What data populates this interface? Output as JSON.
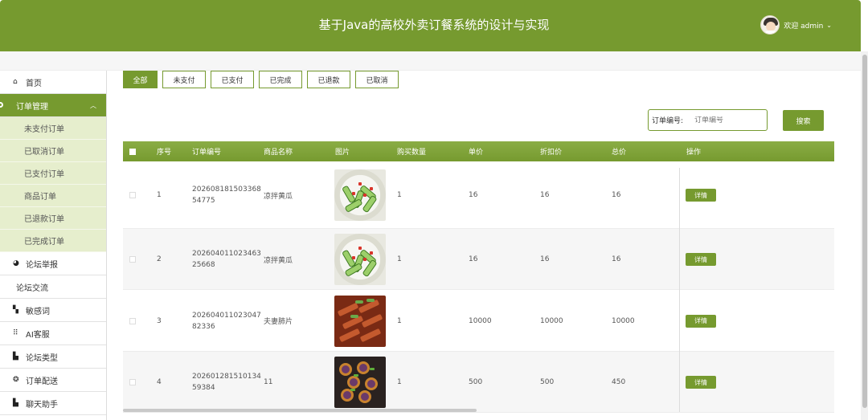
{
  "header": {
    "title": "基于Java的高校外卖订餐系统的设计与实现",
    "welcome": "欢迎 admin"
  },
  "sidebar": {
    "items": [
      {
        "label": "首页",
        "icon": "home-icon"
      },
      {
        "label": "订单管理",
        "icon": "gear-icon"
      },
      {
        "label": "未支付订单"
      },
      {
        "label": "已取消订单"
      },
      {
        "label": "已支付订单"
      },
      {
        "label": "商品订单"
      },
      {
        "label": "已退款订单"
      },
      {
        "label": "已完成订单"
      },
      {
        "label": "论坛举报",
        "icon": "pie-icon"
      },
      {
        "label": "论坛交流"
      },
      {
        "label": "敏感词",
        "icon": "grid-icon"
      },
      {
        "label": "AI客服",
        "icon": "dots-grid-icon"
      },
      {
        "label": "论坛类型",
        "icon": "folder-icon"
      },
      {
        "label": "订单配送",
        "icon": "globe-icon"
      },
      {
        "label": "聊天助手",
        "icon": "chat-icon"
      }
    ]
  },
  "tabs": [
    "全部",
    "未支付",
    "已支付",
    "已完成",
    "已退款",
    "已取消"
  ],
  "search": {
    "label": "订单编号:",
    "placeholder": "订单编号",
    "button": "搜索"
  },
  "table": {
    "headers": [
      "序号",
      "订单编号",
      "商品名称",
      "图片",
      "购买数量",
      "单价",
      "折扣价",
      "总价",
      "操作"
    ],
    "rows": [
      {
        "index": "1",
        "order_no_1": "202608181503368",
        "order_no_2": "54775",
        "name": "凉拌黄瓜",
        "image": "cucumber",
        "qty": "1",
        "price": "16",
        "discount": "16",
        "total": "16",
        "action": "详情"
      },
      {
        "index": "2",
        "order_no_1": "202604011023463",
        "order_no_2": "25668",
        "name": "凉拌黄瓜",
        "image": "cucumber",
        "qty": "1",
        "price": "16",
        "discount": "16",
        "total": "16",
        "action": "详情"
      },
      {
        "index": "3",
        "order_no_1": "202604011023047",
        "order_no_2": "82336",
        "name": "夫妻肺片",
        "image": "tripe",
        "qty": "1",
        "price": "10000",
        "discount": "10000",
        "total": "10000",
        "action": "详情"
      },
      {
        "index": "4",
        "order_no_1": "202601281510134",
        "order_no_2": "59384",
        "name": "11",
        "image": "eggplant",
        "qty": "1",
        "price": "500",
        "discount": "500",
        "total": "450",
        "action": "详情"
      }
    ]
  },
  "colors": {
    "accent": "#769a2f",
    "submenu_bg": "#e6eecd"
  }
}
